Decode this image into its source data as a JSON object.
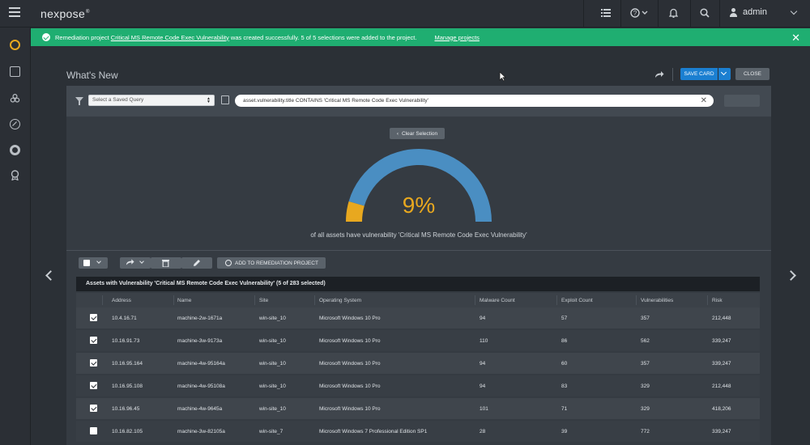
{
  "topbar": {
    "brand": "nexpose",
    "brand_mark": "®",
    "user_name": "admin"
  },
  "banner": {
    "prefix": "Remediation project ",
    "project_link": "Critical MS Remote Code Exec Vulnerability",
    "suffix": " was created successfully. 5 of 5 selections were added to the project.",
    "manage_link": "Manage projects",
    "close": "✕",
    "color": "#1fae71"
  },
  "page": {
    "title": "What's New",
    "save_card": "SAVE CARD",
    "close": "CLOSE"
  },
  "filter": {
    "saved_query_placeholder": "Select a Saved Query",
    "query_text": "asset.vulnerability.title CONTAINS 'Critical MS Remote Code Exec Vulnerability'",
    "clear": "✕"
  },
  "gauge": {
    "clear_selection": "Clear Selection",
    "percent_label": "9%",
    "percent_value": 9,
    "caption": "of all assets have vulnerability 'Critical MS Remote Code Exec Vulnerability'",
    "filled_color": "#e8a81f",
    "remaining_color": "#4a8ec2"
  },
  "toolbar": {
    "add_remediation": "ADD TO REMEDIATION PROJECT"
  },
  "table": {
    "title": "Assets with Vulnerability 'Critical MS Remote Code Exec Vulnerability' (5 of 283 selected)",
    "columns": [
      "Address",
      "Name",
      "Site",
      "Operating System",
      "Malware Count",
      "Exploit Count",
      "Vulnerabilities",
      "Risk"
    ],
    "rows": [
      {
        "checked": true,
        "cells": [
          "10.4.16.71",
          "machine-2w-1671a",
          "win-site_10",
          "Microsoft Windows 10 Pro",
          "94",
          "57",
          "357",
          "212,448"
        ]
      },
      {
        "checked": true,
        "cells": [
          "10.16.91.73",
          "machine-3w-9173a",
          "win-site_10",
          "Microsoft Windows 10 Pro",
          "110",
          "86",
          "562",
          "339,247"
        ]
      },
      {
        "checked": true,
        "cells": [
          "10.16.95.164",
          "machine-4w-95164a",
          "win-site_10",
          "Microsoft Windows 10 Pro",
          "94",
          "60",
          "357",
          "339,247"
        ]
      },
      {
        "checked": true,
        "cells": [
          "10.16.95.108",
          "machine-4w-95108a",
          "win-site_10",
          "Microsoft Windows 10 Pro",
          "94",
          "83",
          "329",
          "212,448"
        ]
      },
      {
        "checked": true,
        "cells": [
          "10.16.96.45",
          "machine-4w-9645a",
          "win-site_10",
          "Microsoft Windows 10 Pro",
          "101",
          "71",
          "329",
          "418,206"
        ]
      },
      {
        "checked": false,
        "cells": [
          "10.16.82.105",
          "machine-3w-82105a",
          "win-site_7",
          "Microsoft Windows 7 Professional Edition SP1",
          "28",
          "39",
          "772",
          "339,247"
        ]
      }
    ]
  }
}
